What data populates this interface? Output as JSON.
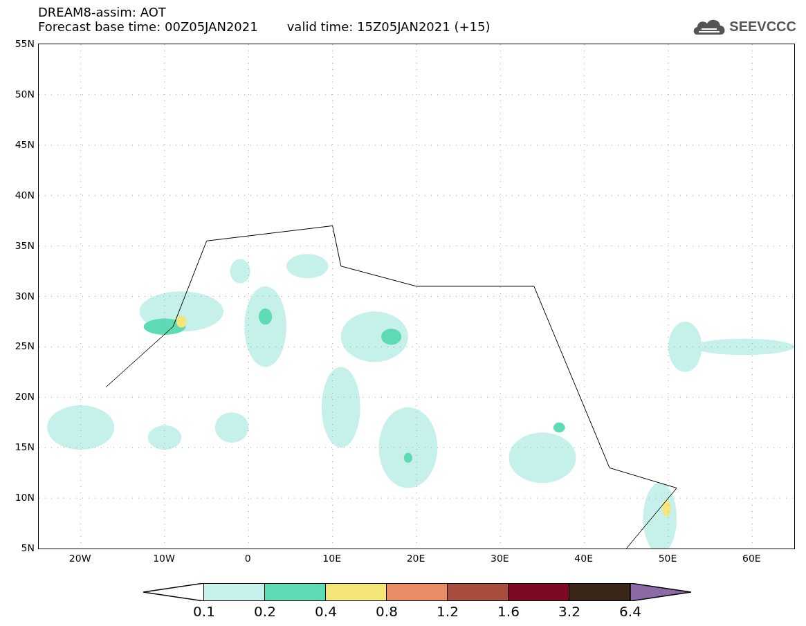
{
  "title": "DREAM8-assim: AOT",
  "forecast_base": "Forecast base time: 00Z05JAN2021",
  "valid_time": "valid time: 15Z05JAN2021 (+15)",
  "logo": "SEEVCCC",
  "y_ticks": [
    "55N",
    "50N",
    "45N",
    "40N",
    "35N",
    "30N",
    "25N",
    "20N",
    "15N",
    "10N",
    "5N"
  ],
  "x_ticks": [
    "20W",
    "10W",
    "0",
    "10E",
    "20E",
    "30E",
    "40E",
    "50E",
    "60E"
  ],
  "legend": {
    "bins": [
      {
        "kind": "under",
        "color": "#ffffff"
      },
      {
        "kind": "box",
        "color": "#c6f0ea"
      },
      {
        "kind": "box",
        "color": "#5ddbb5"
      },
      {
        "kind": "box",
        "color": "#f5e67a"
      },
      {
        "kind": "box",
        "color": "#e88d65"
      },
      {
        "kind": "box",
        "color": "#a84e3e"
      },
      {
        "kind": "box",
        "color": "#7d0a25"
      },
      {
        "kind": "box",
        "color": "#3a2618"
      },
      {
        "kind": "over",
        "color": "#8b6aa6"
      }
    ],
    "labels": [
      "0.1",
      "0.2",
      "0.4",
      "0.8",
      "1.2",
      "1.6",
      "3.2",
      "6.4"
    ]
  }
}
